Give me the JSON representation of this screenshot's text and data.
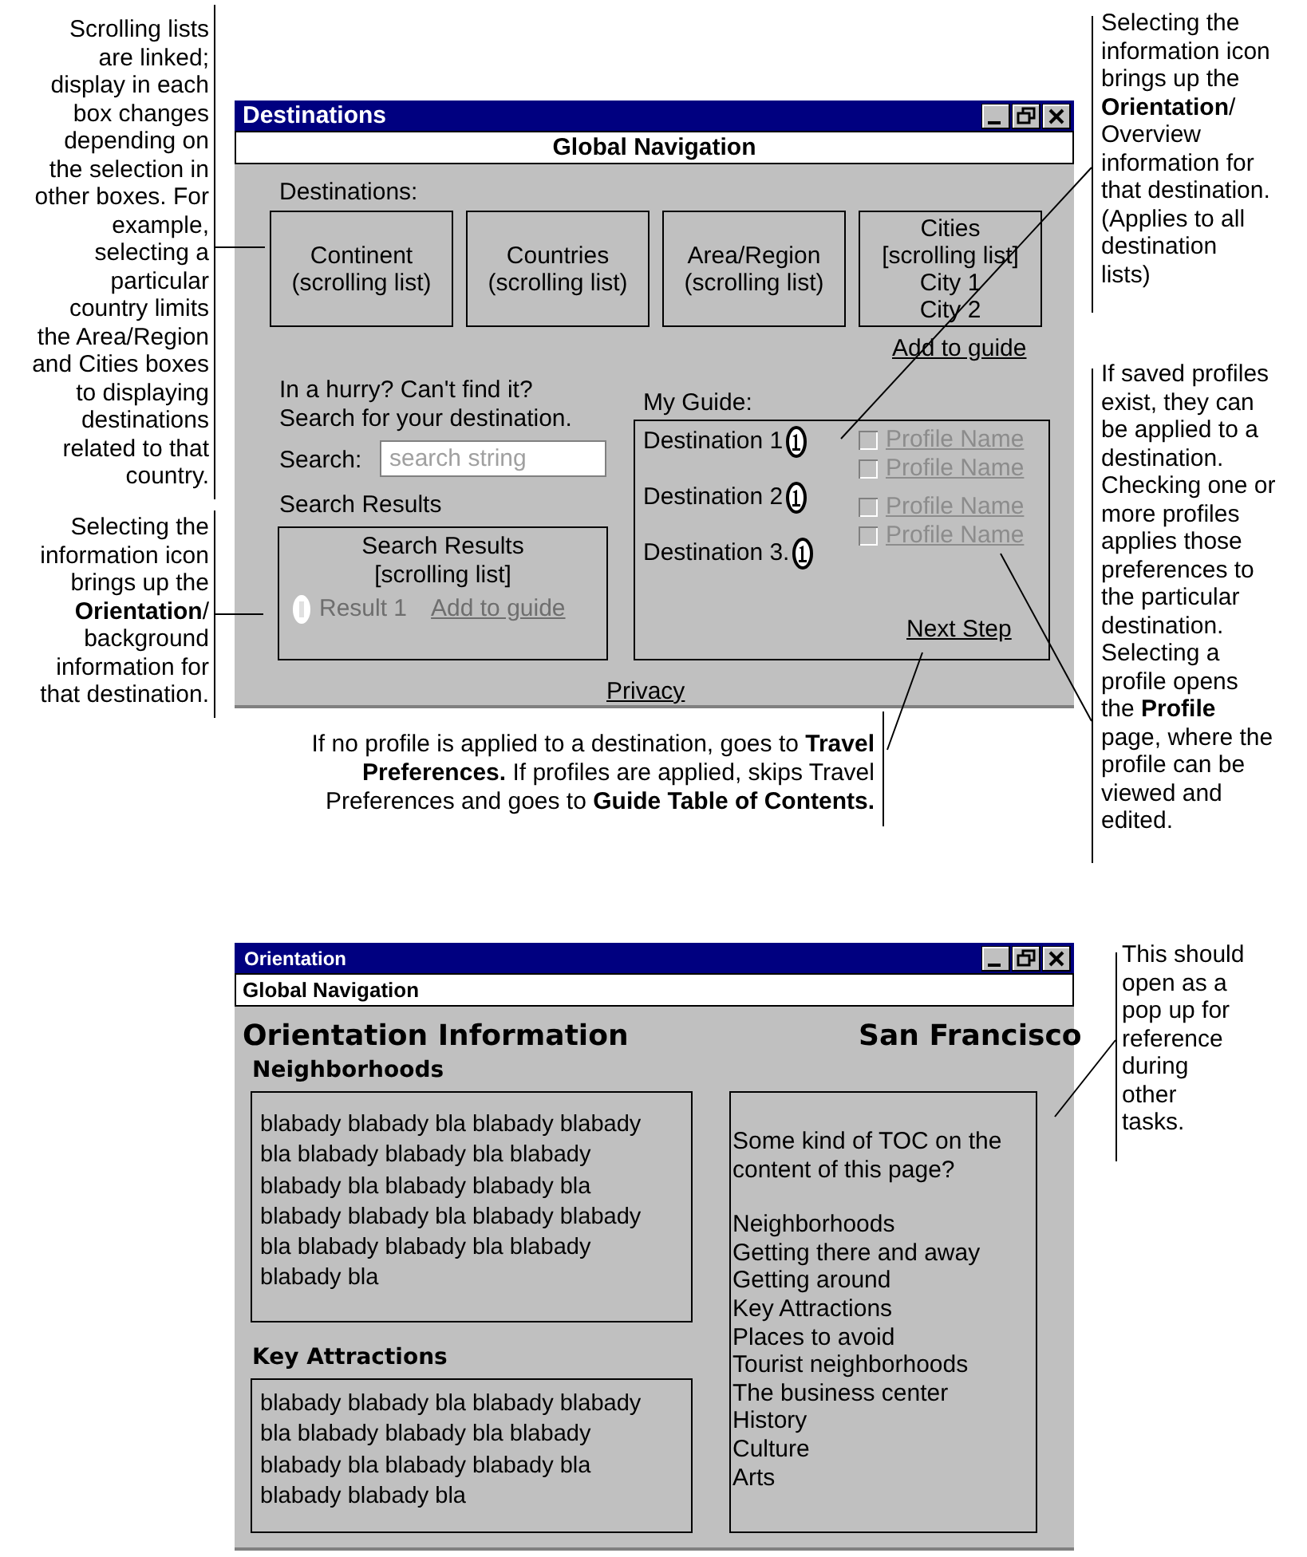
{
  "annotations": [
    {
      "text": "Scrolling lists\nare linked;\ndisplay in each\nbox changes\ndepending on\nthe selection in\nother boxes. For\nexample,\nselecting a\nparticular\ncountry limits\nthe Area/Region\nand Cities boxes\nto displaying\ndestinations\nrelated to that\ncountry."
    },
    {
      "text": "Selecting the\ninformation icon\nbrings up the\n**Orientation**/\nOverview\ninformation for\nthat destination.\n(Applies to all\ndestination\nlists)"
    },
    {
      "text": "If saved profiles\nexist, they can\nbe applied to a\ndestination.\nChecking one or\nmore profiles\napplies those\npreferences to\nthe particular\ndestination.\nSelecting a\nprofile opens\nthe **Profile**\npage, where the\nprofile can be\nviewed and\nedited."
    },
    {
      "text": "Selecting the\ninformation icon\nbrings up the\n**Orientation**/\nbackground\ninformation for\nthat destination."
    },
    {
      "text": "If no profile is applied to a destination, goes to **Travel**\n**Preferences.** If profiles are applied, skips Travel\nPreferences and goes to **Guide Table of Contents.**"
    },
    {
      "text": "This should\nopen as a\npop up for\nreference\nduring\nother\ntasks."
    }
  ],
  "destinations_window": {
    "title": "Destinations",
    "global_nav": "Global Navigation",
    "destinations_label": "Destinations:",
    "lists": [
      {
        "lines": [
          "Continent",
          "(scrolling list)"
        ]
      },
      {
        "lines": [
          "Countries",
          "(scrolling list)"
        ]
      },
      {
        "lines": [
          "Area/Region",
          "(scrolling list)"
        ]
      },
      {
        "lines": [
          "Cities",
          "[scrolling list]",
          "City 1",
          "City 2"
        ]
      }
    ],
    "add_to_guide": "Add to guide",
    "search_intro": "In a hurry? Can't find it?\nSearch for your destination.",
    "search_label": "Search:",
    "search": {
      "placeholder": "search string"
    },
    "results_label": "Search Results",
    "results_box": {
      "heading": "Search Results\n[scrolling list]",
      "result": {
        "name": "Result 1",
        "link": "Add to guide",
        "disabled": true
      }
    },
    "guide_label": "My Guide:",
    "guide": [
      {
        "name": "Destination 1"
      },
      {
        "name": "Destination 2"
      },
      {
        "name": "Destination 3."
      }
    ],
    "profiles": [
      {
        "name": "Profile Name",
        "checked": false
      },
      {
        "name": "Profile Name",
        "checked": false
      },
      {
        "name": "Profile Name",
        "checked": false
      },
      {
        "name": "Profile Name",
        "checked": false
      }
    ],
    "next_step": "Next Step",
    "privacy": "Privacy"
  },
  "orientation_window": {
    "title": "Orientation",
    "global_nav": "Global Navigation",
    "heading": "Orientation Information",
    "city": "San Francisco",
    "sections": [
      {
        "title": "Neighborhoods",
        "body": "blabady blabady bla blabady blabady bla blabady blabady bla blabady blabady bla blabady blabady bla blabady blabady bla blabady blabady bla blabady blabady bla blabady blabady bla"
      },
      {
        "title": "Key Attractions",
        "body": "blabady blabady bla blabady blabady bla blabady blabady bla blabady blabady bla blabady blabady bla blabady blabady bla"
      }
    ],
    "toc_intro": "Some kind of TOC on the content of this page?",
    "toc": [
      "Neighborhoods",
      "Getting there and away",
      "Getting around",
      "Key Attractions",
      "Places to avoid",
      "Tourist neighborhoods",
      "The business center",
      "History",
      "Culture",
      "Arts"
    ]
  }
}
